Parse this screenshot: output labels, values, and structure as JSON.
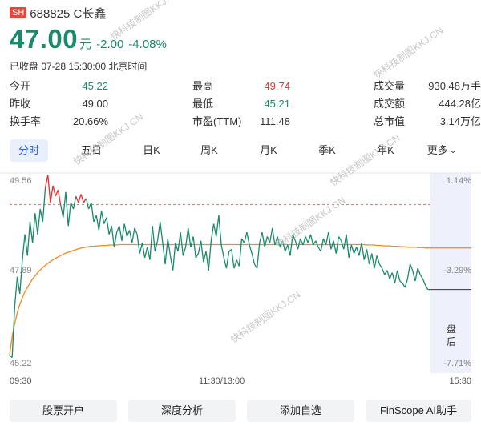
{
  "header": {
    "exchange_badge": "SH",
    "code_name": "688825 C长鑫"
  },
  "quote": {
    "price": "47.00",
    "unit": "元",
    "change": "-2.00",
    "change_pct": "-4.08%",
    "status": "已收盘 07-28 15:30:00 北京时间"
  },
  "stats": {
    "open": {
      "label": "今开",
      "value": "45.22"
    },
    "prev_close": {
      "label": "昨收",
      "value": "49.00"
    },
    "turnover": {
      "label": "换手率",
      "value": "20.66%"
    },
    "high": {
      "label": "最高",
      "value": "49.74"
    },
    "low": {
      "label": "最低",
      "value": "45.21"
    },
    "pe": {
      "label": "市盈(TTM)",
      "value": "111.48"
    },
    "volume": {
      "label": "成交量",
      "value": "930.48万手"
    },
    "amount": {
      "label": "成交额",
      "value": "444.28亿"
    },
    "market_cap": {
      "label": "总市值",
      "value": "3.14万亿"
    }
  },
  "tabs": [
    "分时",
    "五日",
    "日K",
    "周K",
    "月K",
    "季K",
    "年K",
    "更多"
  ],
  "chart_labels": {
    "top_price": "49.56",
    "mid_price": "47.89",
    "bottom_price": "45.22",
    "top_pct": "1.14%",
    "mid_pct": "-3.29%",
    "bottom_pct": "-7.71%",
    "closed_label": "盘后"
  },
  "time_axis": {
    "start": "09:30",
    "mid": "11:30/13:00",
    "end": "15:30"
  },
  "actions": [
    "股票开户",
    "深度分析",
    "添加自选",
    "FinScope AI助手"
  ],
  "watermark": "快科技制图KKJ.CN",
  "colors": {
    "down": "#1a8a6a",
    "up": "#e03030",
    "avg_line": "#f08a24",
    "accent": "#2b63d9",
    "badge": "#e8453c"
  },
  "chart_data": {
    "type": "line",
    "ylim": [
      45.22,
      49.56
    ],
    "prev_close": 49.0,
    "x_ticks": [
      "09:30",
      "11:30/13:00",
      "15:30"
    ],
    "price_series": [
      45.45,
      45.4,
      46.6,
      47.3,
      46.9,
      47.7,
      48.3,
      47.8,
      48.6,
      48.1,
      48.8,
      48.3,
      48.9,
      48.6,
      49.4,
      49.7,
      49.05,
      49.45,
      49.2,
      49.35,
      49.0,
      48.7,
      49.3,
      48.5,
      49.05,
      48.9,
      49.2,
      49.05,
      49.25,
      49.05,
      49.15,
      48.9,
      49.05,
      48.6,
      48.75,
      48.4,
      48.85,
      48.55,
      48.7,
      48.3,
      48.5,
      48.0,
      48.35,
      48.5,
      48.15,
      48.55,
      48.25,
      48.4,
      48.1,
      48.45,
      48.3,
      47.85,
      48.1,
      47.75,
      48.0,
      47.7,
      48.5,
      47.9,
      48.15,
      48.6,
      48.1,
      47.6,
      48.2,
      47.8,
      47.45,
      48.1,
      47.9,
      48.35,
      47.8,
      48.0,
      48.45,
      48.0,
      48.25,
      47.75,
      47.85,
      48.15,
      47.65,
      47.9,
      47.45,
      48.15,
      48.55,
      48.25,
      48.75,
      48.05,
      47.75,
      47.5,
      47.9,
      47.95,
      47.5,
      47.7,
      47.55,
      48.2,
      48.1,
      48.35,
      48.05,
      47.85,
      47.6,
      47.5,
      48.1,
      48.35,
      48.0,
      48.25,
      48.1,
      48.45,
      48.05,
      48.25,
      48.0,
      48.15,
      47.9,
      48.05,
      47.8,
      48.3,
      48.15,
      47.95,
      48.2,
      48.05,
      48.25,
      48.1,
      48.3,
      48.05,
      48.15,
      48.0,
      47.9,
      48.2,
      48.05,
      48.35,
      47.95,
      48.15,
      47.85,
      48.25,
      48.15,
      47.95,
      48.3,
      47.75,
      48.05,
      47.85,
      48.0,
      47.8,
      48.1,
      47.7,
      47.95,
      47.6,
      47.85,
      47.5,
      47.8,
      47.6,
      47.5,
      47.35,
      47.45,
      47.25,
      47.4,
      47.15,
      47.45,
      47.2,
      47.15,
      47.05,
      47.25,
      47.6,
      47.45,
      47.2,
      47.5,
      47.35,
      47.25,
      47.1,
      47.0,
      47.0
    ],
    "avg_series": [
      45.45,
      45.9,
      46.2,
      46.45,
      46.65,
      46.8,
      46.95,
      47.05,
      47.15,
      47.25,
      47.32,
      47.4,
      47.46,
      47.52,
      47.57,
      47.62,
      47.66,
      47.7,
      47.74,
      47.77,
      47.8,
      47.83,
      47.86,
      47.88,
      47.9,
      47.92,
      47.94,
      47.96,
      47.98,
      47.99,
      48.0,
      48.01,
      48.02,
      48.02,
      48.03,
      48.03,
      48.04,
      48.04,
      48.04,
      48.05,
      48.05,
      48.05,
      48.05,
      48.06,
      48.06,
      48.06,
      48.06,
      48.06,
      48.06,
      48.06,
      48.06,
      48.06,
      48.06,
      48.06,
      48.06,
      48.06,
      48.06,
      48.06,
      48.06,
      48.06,
      48.06,
      48.06,
      48.06,
      48.06,
      48.06,
      48.06,
      48.06,
      48.06,
      48.06,
      48.06,
      48.06,
      48.06,
      48.06,
      48.06,
      48.06,
      48.06,
      48.06,
      48.06,
      48.06,
      48.06,
      48.06,
      48.06,
      48.06,
      48.06,
      48.06,
      48.06,
      48.06,
      48.06,
      48.06,
      48.06,
      48.06,
      48.06,
      48.06,
      48.06,
      48.06,
      48.06,
      48.06,
      48.06,
      48.06,
      48.06,
      48.06,
      48.06,
      48.06,
      48.06,
      48.06,
      48.06,
      48.06,
      48.06,
      48.06,
      48.06,
      48.06,
      48.06,
      48.06,
      48.06,
      48.06,
      48.06,
      48.06,
      48.06,
      48.06,
      48.06,
      48.06,
      48.06,
      48.06,
      48.06,
      48.06,
      48.06,
      48.06,
      48.06,
      48.06,
      48.06,
      48.06,
      48.06,
      48.06,
      48.06,
      48.06,
      48.06,
      48.06,
      48.06,
      48.06,
      48.06,
      48.05,
      48.05,
      48.05,
      48.05,
      48.04,
      48.04,
      48.04,
      48.03,
      48.03,
      48.03,
      48.02,
      48.02,
      48.02,
      48.01,
      48.01,
      48.01,
      48.0,
      48.0,
      48.0,
      48.0,
      47.99,
      47.99,
      47.99,
      47.98,
      47.98,
      47.98
    ],
    "y_ticks_left": [
      "49.56",
      "47.89",
      "45.22"
    ],
    "y_ticks_right": [
      "1.14%",
      "-3.29%",
      "-7.71%"
    ]
  }
}
